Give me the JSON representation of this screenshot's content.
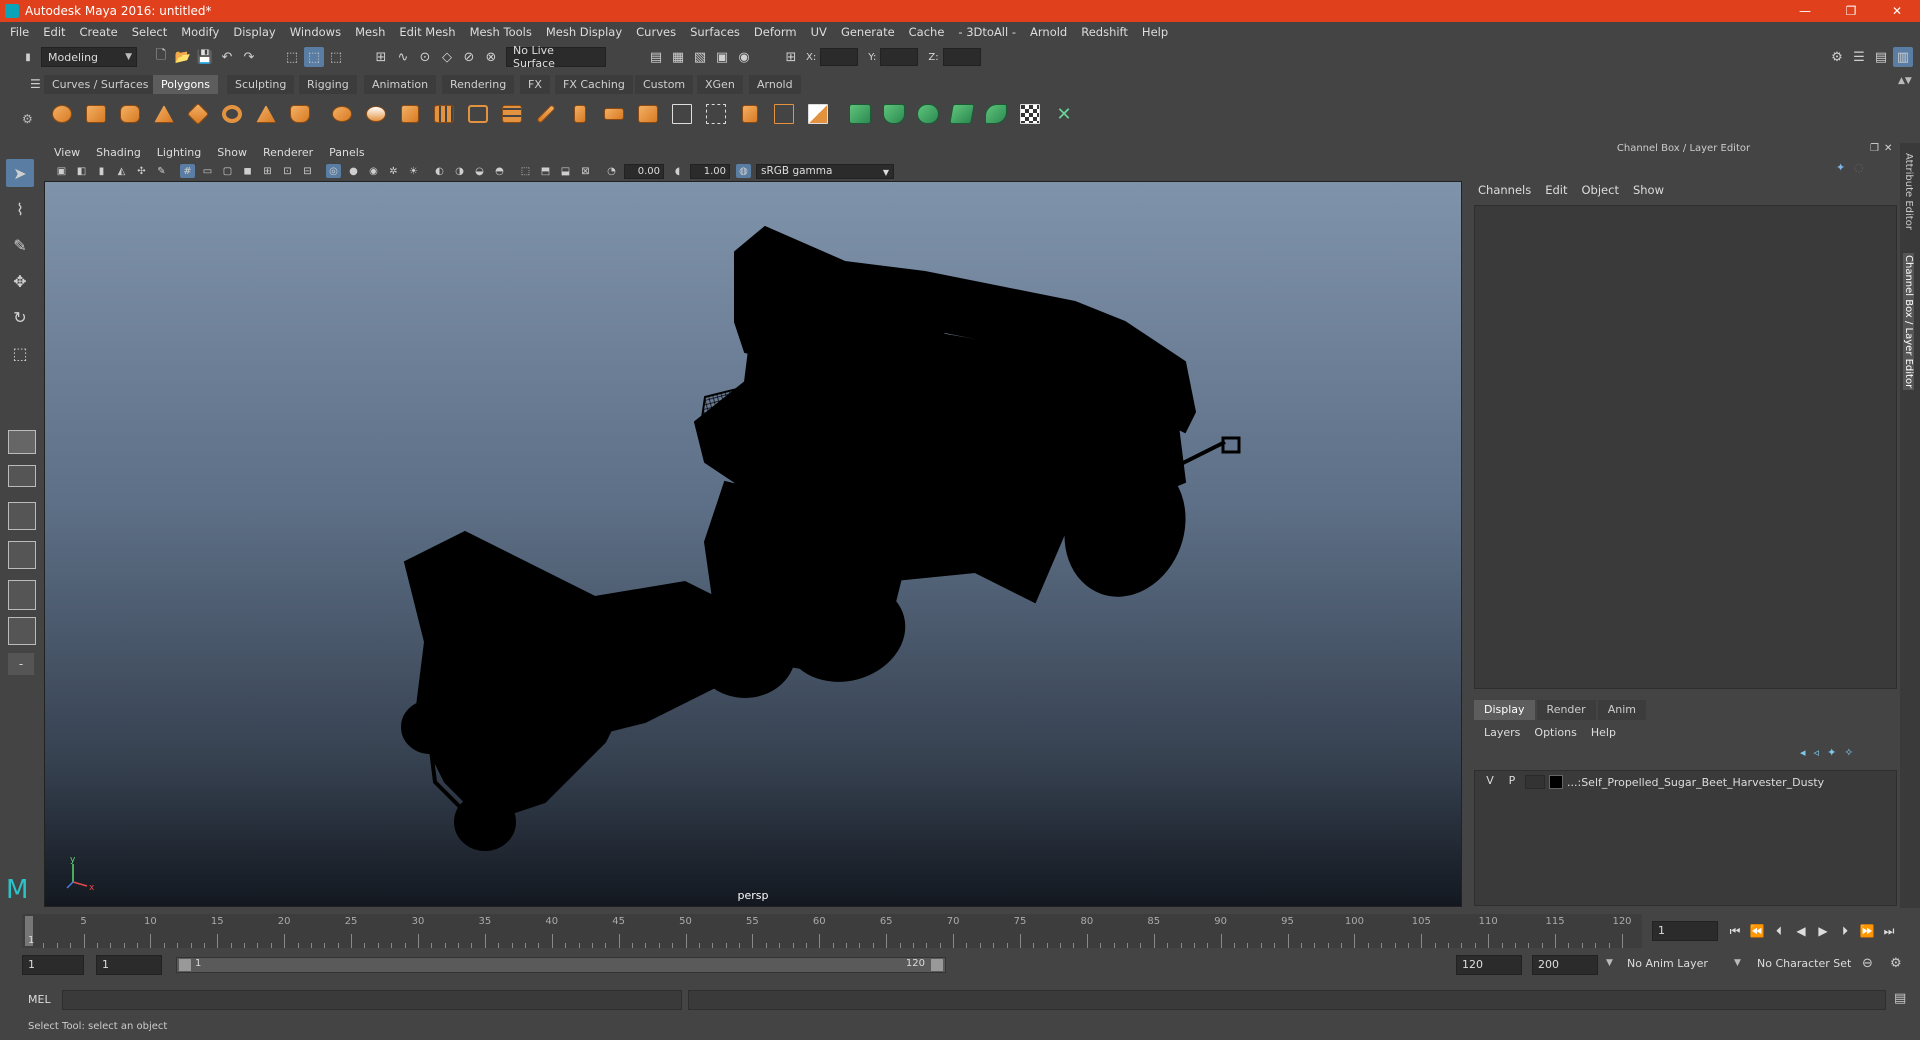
{
  "window": {
    "title": "Autodesk Maya 2016: untitled*",
    "min": "—",
    "max": "❐",
    "close": "✕"
  },
  "menu": [
    "File",
    "Edit",
    "Create",
    "Select",
    "Modify",
    "Display",
    "Windows",
    "Mesh",
    "Edit Mesh",
    "Mesh Tools",
    "Mesh Display",
    "Curves",
    "Surfaces",
    "Deform",
    "UV",
    "Generate",
    "Cache",
    "- 3DtoAll -",
    "Arnold",
    "Redshift",
    "Help"
  ],
  "status_line": {
    "mode": "Modeling",
    "live_surface": "No Live Surface",
    "x_label": "X:",
    "y_label": "Y:",
    "z_label": "Z:"
  },
  "shelf_tabs": [
    "Curves / Surfaces",
    "Polygons",
    "Sculpting",
    "Rigging",
    "Animation",
    "Rendering",
    "FX",
    "FX Caching",
    "Custom",
    "XGen",
    "Arnold"
  ],
  "active_shelf_tab": "Polygons",
  "viewport": {
    "menu": [
      "View",
      "Shading",
      "Lighting",
      "Show",
      "Renderer",
      "Panels"
    ],
    "exposure": "0.00",
    "gamma": "1.00",
    "color_space": "sRGB gamma",
    "camera_label": "persp",
    "axis_y": "y",
    "axis_x": "x"
  },
  "channel_box": {
    "title": "Channel Box / Layer Editor",
    "menu": [
      "Channels",
      "Edit",
      "Object",
      "Show"
    ]
  },
  "layer_editor": {
    "tabs": [
      "Display",
      "Render",
      "Anim"
    ],
    "active_tab": "Display",
    "menu": [
      "Layers",
      "Options",
      "Help"
    ],
    "layer": {
      "v": "V",
      "p": "P",
      "name": "...:Self_Propelled_Sugar_Beet_Harvester_Dusty"
    }
  },
  "side_tabs": {
    "attribute_editor": "Attribute Editor",
    "channel_box": "Channel Box / Layer Editor"
  },
  "time_slider": {
    "ticks": [
      "5",
      "10",
      "15",
      "20",
      "25",
      "30",
      "35",
      "40",
      "45",
      "50",
      "55",
      "60",
      "65",
      "70",
      "75",
      "80",
      "85",
      "90",
      "95",
      "100",
      "105",
      "110",
      "115",
      "120"
    ],
    "first_label": "1",
    "current_frame": "1"
  },
  "range": {
    "start_frame": "1",
    "playback_start": "1",
    "range_start": "1",
    "range_end": "120",
    "playback_end": "120",
    "end_frame": "200",
    "anim_layer": "No Anim Layer",
    "character_set": "No Character Set"
  },
  "mel": {
    "label": "MEL"
  },
  "status": {
    "help_line": "Select Tool: select an object"
  },
  "colors": {
    "title_bar": "#e0401b",
    "ui_bg": "#444444",
    "accent": "#5a7da3",
    "viewport_top": "#7f93ab",
    "viewport_bottom": "#131820"
  }
}
